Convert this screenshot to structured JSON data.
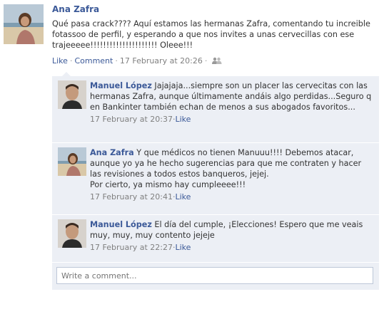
{
  "post": {
    "author": "Ana Zafra",
    "text": "Qué pasa crack???? Aquí estamos las hermanas Zafra, comentando tu increible fotassoo de perfil, y esperando a que nos invites a unas cervecillas con ese trajeeeee!!!!!!!!!!!!!!!!!!!!! Oleee!!!",
    "like_label": "Like",
    "comment_label": "Comment",
    "timestamp": "17 February at 20:26",
    "separator": "·"
  },
  "comments": [
    {
      "author": "Manuel López",
      "text": "Jajajaja...siempre son un placer las cervecitas con las hermanas Zafra, aunque últimamente andáis algo perdidas...Seguro q en Bankinter también echan de menos a sus abogados favoritos...",
      "timestamp": "17 February at 20:37",
      "like_label": "Like"
    },
    {
      "author": "Ana Zafra",
      "text": "Y que médicos no tienen Manuuu!!!! Debemos atacar, aunque yo ya he hecho sugerencias para que me contraten y hacer las revisiones a todos estos banqueros, jejej.\nPor cierto, ya mismo hay cumpleeee!!!",
      "timestamp": "17 February at 20:41",
      "like_label": "Like"
    },
    {
      "author": "Manuel López",
      "text": "El día del cumple, ¡Elecciones! Espero que me veais muy, muy, muy contento jejeje",
      "timestamp": "17 February at 22:27",
      "like_label": "Like"
    }
  ],
  "comment_input": {
    "placeholder": "Write a comment..."
  },
  "colors": {
    "link": "#3b5998",
    "comment_bg": "#eceff5",
    "meta": "#808080"
  }
}
